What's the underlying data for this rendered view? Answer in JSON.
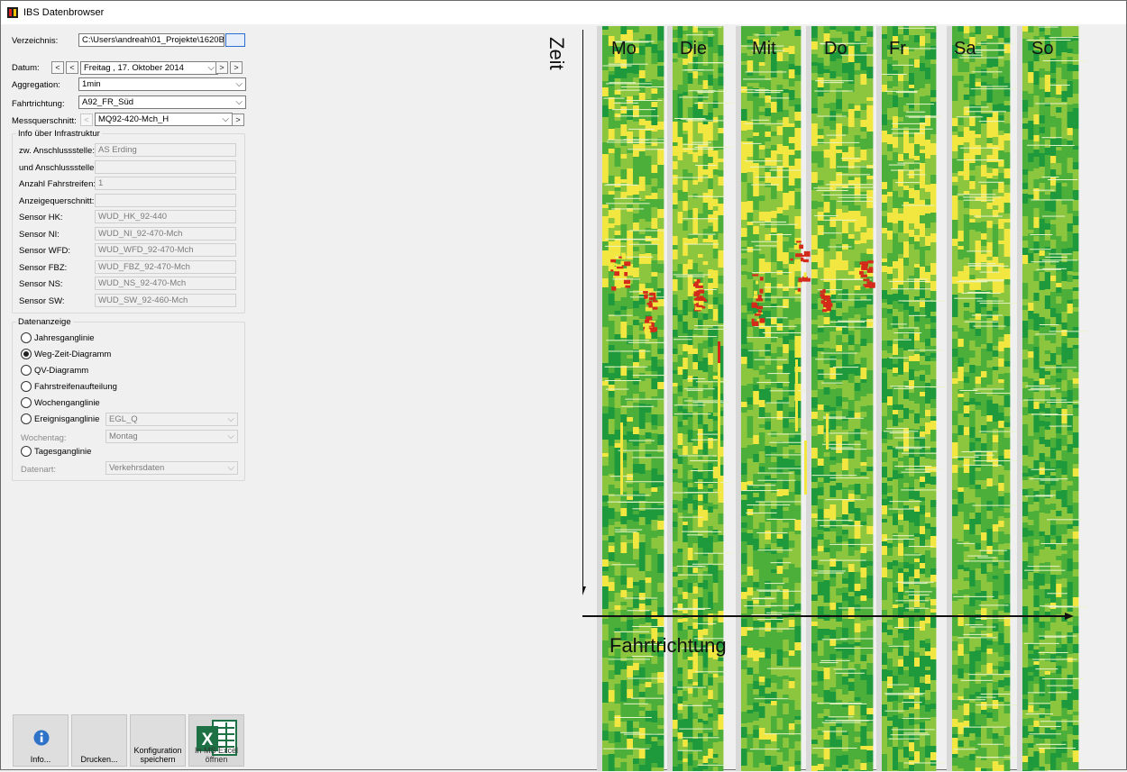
{
  "window": {
    "title": "IBS Datenbrowser"
  },
  "form": {
    "verzeichnis_label": "Verzeichnis:",
    "verzeichnis_value": "C:\\Users\\andreah\\01_Projekte\\1620B/",
    "browse_label": "...",
    "datum_label": "Datum:",
    "datum_value": "Freitag   , 17.  Oktober  2014",
    "aggregation_label": "Aggregation:",
    "aggregation_value": "1min",
    "fahrtrichtung_label": "Fahrtrichtung:",
    "fahrtrichtung_value": "A92_FR_Süd",
    "messquerschnitt_label": "Messquerschnitt:",
    "messquerschnitt_value": "MQ92-420-Mch_H"
  },
  "info": {
    "title": "Info über Infrastruktur",
    "rows": [
      {
        "label": "zw. Anschlussstelle:",
        "value": "AS Erding"
      },
      {
        "label": "und Anschlussstelle:",
        "value": ""
      },
      {
        "label": "Anzahl Fahrstreifen:",
        "value": "1"
      },
      {
        "label": "Anzeigequerschnitt:",
        "value": ""
      },
      {
        "label": "Sensor HK:",
        "value": "WUD_HK_92-440"
      },
      {
        "label": "Sensor NI:",
        "value": "WUD_NI_92-470-Mch"
      },
      {
        "label": "Sensor WFD:",
        "value": "WUD_WFD_92-470-Mch"
      },
      {
        "label": "Sensor FBZ:",
        "value": "WUD_FBZ_92-470-Mch"
      },
      {
        "label": "Sensor NS:",
        "value": "WUD_NS_92-470-Mch"
      },
      {
        "label": "Sensor SW:",
        "value": "WUD_SW_92-460-Mch"
      }
    ]
  },
  "datenanzeige": {
    "title": "Datenanzeige",
    "options": [
      {
        "label": "Jahresganglinie",
        "selected": false
      },
      {
        "label": "Weg-Zeit-Diagramm",
        "selected": true
      },
      {
        "label": "QV-Diagramm",
        "selected": false
      },
      {
        "label": "Fahrstreifenaufteilung",
        "selected": false
      },
      {
        "label": "Wochenganglinie",
        "selected": false
      },
      {
        "label": "Ereignisganglinie",
        "selected": false
      },
      {
        "label": "Tagesganglinie",
        "selected": false
      }
    ],
    "ereignis_value": "EGL_Q",
    "wochentag_label": "Wochentag:",
    "wochentag_value": "Montag",
    "datenart_label": "Datenart:",
    "datenart_value": "Verkehrsdaten"
  },
  "buttons": {
    "info": "Info...",
    "drucken": "Drucken...",
    "konfig_1": "Konfiguration",
    "konfig_2": "speichern",
    "excel_1": "In MS Excel",
    "excel_2": "öffnen"
  },
  "chart": {
    "days": [
      "Mo",
      "Die",
      "Mit",
      "Do",
      "Fr",
      "Sa",
      "So"
    ],
    "y_axis_label": "Zeit",
    "x_axis_label": "Fahrtrichtung"
  },
  "colors": {
    "green_dark": "#1e9a3c",
    "green": "#4caf3a",
    "green_light": "#8cc63f",
    "yellow": "#f2e640",
    "red": "#d42a1a",
    "excel_green": "#1e7145"
  }
}
